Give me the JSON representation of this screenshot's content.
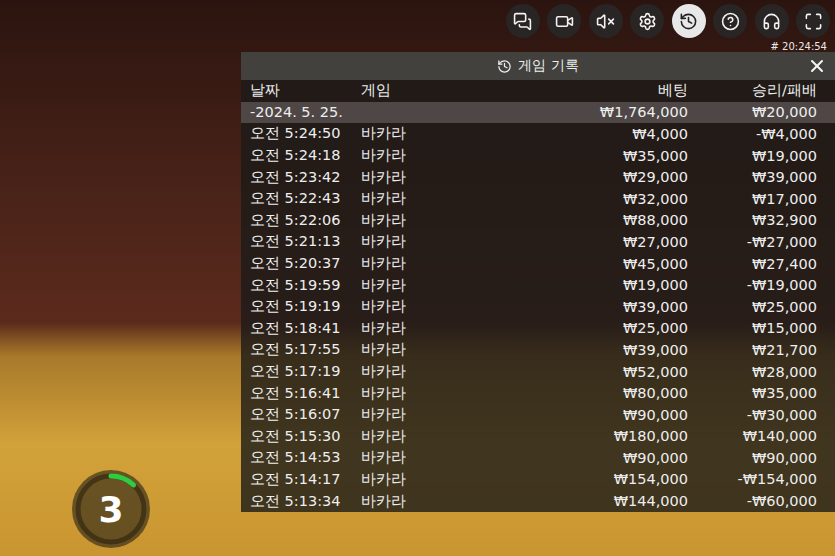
{
  "toolbar": [
    {
      "selected": false
    },
    {
      "selected": false
    },
    {
      "selected": false
    },
    {
      "selected": false
    },
    {
      "selected": true
    },
    {
      "selected": false
    },
    {
      "selected": false
    },
    {
      "selected": false
    }
  ],
  "timestamp": "# 20:24:54",
  "panel": {
    "title": "게임 기록",
    "columns": [
      "날짜",
      "게임",
      "베팅",
      "승리/패배"
    ],
    "summary": {
      "date": "-2024. 5. 25.",
      "bet": "₩1,764,000",
      "result": "₩20,000"
    },
    "rows": [
      {
        "time": "오전 5:24:50",
        "game": "바카라",
        "bet": "₩4,000",
        "result": "-₩4,000"
      },
      {
        "time": "오전 5:24:18",
        "game": "바카라",
        "bet": "₩35,000",
        "result": "₩19,000"
      },
      {
        "time": "오전 5:23:42",
        "game": "바카라",
        "bet": "₩29,000",
        "result": "₩39,000"
      },
      {
        "time": "오전 5:22:43",
        "game": "바카라",
        "bet": "₩32,000",
        "result": "₩17,000"
      },
      {
        "time": "오전 5:22:06",
        "game": "바카라",
        "bet": "₩88,000",
        "result": "₩32,900"
      },
      {
        "time": "오전 5:21:13",
        "game": "바카라",
        "bet": "₩27,000",
        "result": "-₩27,000"
      },
      {
        "time": "오전 5:20:37",
        "game": "바카라",
        "bet": "₩45,000",
        "result": "₩27,400"
      },
      {
        "time": "오전 5:19:59",
        "game": "바카라",
        "bet": "₩19,000",
        "result": "-₩19,000"
      },
      {
        "time": "오전 5:19:19",
        "game": "바카라",
        "bet": "₩39,000",
        "result": "₩25,000"
      },
      {
        "time": "오전 5:18:41",
        "game": "바카라",
        "bet": "₩25,000",
        "result": "₩15,000"
      },
      {
        "time": "오전 5:17:55",
        "game": "바카라",
        "bet": "₩39,000",
        "result": "₩21,700"
      },
      {
        "time": "오전 5:17:19",
        "game": "바카라",
        "bet": "₩52,000",
        "result": "₩28,000"
      },
      {
        "time": "오전 5:16:41",
        "game": "바카라",
        "bet": "₩80,000",
        "result": "₩35,000"
      },
      {
        "time": "오전 5:16:07",
        "game": "바카라",
        "bet": "₩90,000",
        "result": "-₩30,000"
      },
      {
        "time": "오전 5:15:30",
        "game": "바카라",
        "bet": "₩180,000",
        "result": "₩140,000"
      },
      {
        "time": "오전 5:14:53",
        "game": "바카라",
        "bet": "₩90,000",
        "result": "₩90,000"
      },
      {
        "time": "오전 5:14:17",
        "game": "바카라",
        "bet": "₩154,000",
        "result": "-₩154,000"
      },
      {
        "time": "오전 5:13:34",
        "game": "바카라",
        "bet": "₩144,000",
        "result": "-₩60,000"
      }
    ]
  },
  "countdown": {
    "value": "3",
    "level": 0.12
  }
}
